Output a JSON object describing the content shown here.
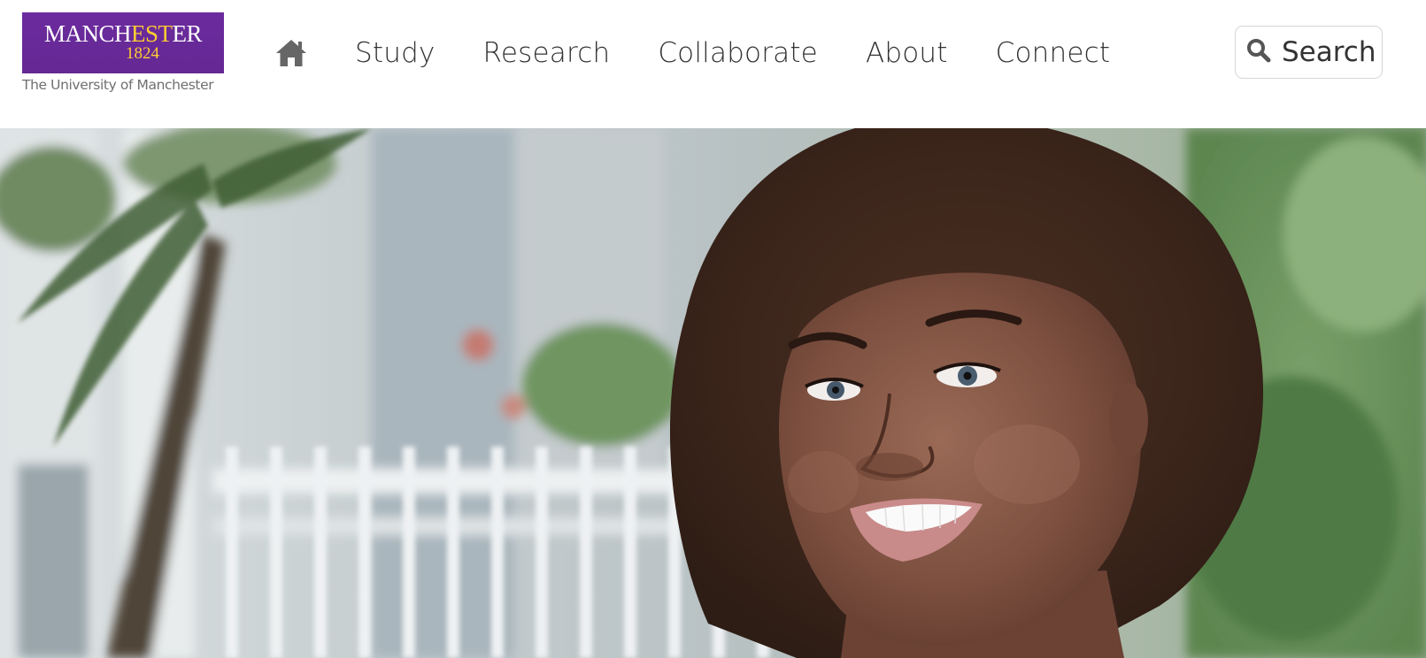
{
  "logo": {
    "word_part1": "MANCH",
    "word_part2": "EST",
    "word_part3": "ER",
    "year": "1824",
    "subtitle": "The University of Manchester",
    "colors": {
      "background": "#660099",
      "accent": "#ffcc33"
    }
  },
  "nav": {
    "home_icon": "home-icon",
    "items": [
      {
        "label": "Study"
      },
      {
        "label": "Research"
      },
      {
        "label": "Collaborate"
      },
      {
        "label": "About"
      },
      {
        "label": "Connect"
      }
    ]
  },
  "search": {
    "icon": "search-icon",
    "label": "Search"
  },
  "hero": {
    "image": "smiling-student-photo"
  }
}
